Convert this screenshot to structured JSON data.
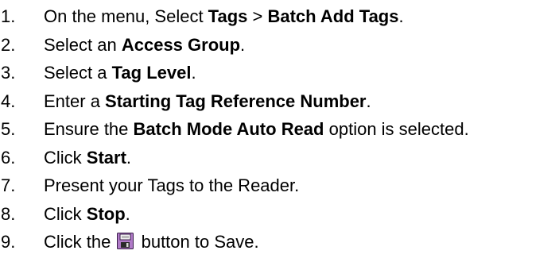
{
  "steps": [
    {
      "number": "1.",
      "parts": [
        {
          "text": "On the menu, Select ",
          "bold": false
        },
        {
          "text": "Tags",
          "bold": true
        },
        {
          "text": " > ",
          "bold": false
        },
        {
          "text": "Batch Add Tags",
          "bold": true
        },
        {
          "text": ".",
          "bold": false
        }
      ]
    },
    {
      "number": "2.",
      "parts": [
        {
          "text": "Select an ",
          "bold": false
        },
        {
          "text": "Access Group",
          "bold": true
        },
        {
          "text": ".",
          "bold": false
        }
      ]
    },
    {
      "number": "3.",
      "parts": [
        {
          "text": "Select a ",
          "bold": false
        },
        {
          "text": "Tag Level",
          "bold": true
        },
        {
          "text": ".",
          "bold": false
        }
      ]
    },
    {
      "number": "4.",
      "parts": [
        {
          "text": "Enter a ",
          "bold": false
        },
        {
          "text": "Starting Tag Reference Number",
          "bold": true
        },
        {
          "text": ".",
          "bold": false
        }
      ]
    },
    {
      "number": "5.",
      "parts": [
        {
          "text": "Ensure the ",
          "bold": false
        },
        {
          "text": "Batch Mode Auto Read",
          "bold": true
        },
        {
          "text": " option is selected.",
          "bold": false
        }
      ]
    },
    {
      "number": "6.",
      "parts": [
        {
          "text": "Click ",
          "bold": false
        },
        {
          "text": "Start",
          "bold": true
        },
        {
          "text": ".",
          "bold": false
        }
      ]
    },
    {
      "number": "7.",
      "parts": [
        {
          "text": "Present your Tags to the Reader.",
          "bold": false
        }
      ]
    },
    {
      "number": "8.",
      "parts": [
        {
          "text": "Click ",
          "bold": false
        },
        {
          "text": "Stop",
          "bold": true
        },
        {
          "text": ".",
          "bold": false
        }
      ]
    },
    {
      "number": "9.",
      "parts": [
        {
          "text": "Click the ",
          "bold": false
        },
        {
          "icon": "floppy-disk-save-icon"
        },
        {
          "text": " button to Save.",
          "bold": false
        }
      ]
    }
  ],
  "colors": {
    "text": "#000000",
    "icon_fill": "#b07ac8",
    "icon_border": "#3a1f4a"
  }
}
